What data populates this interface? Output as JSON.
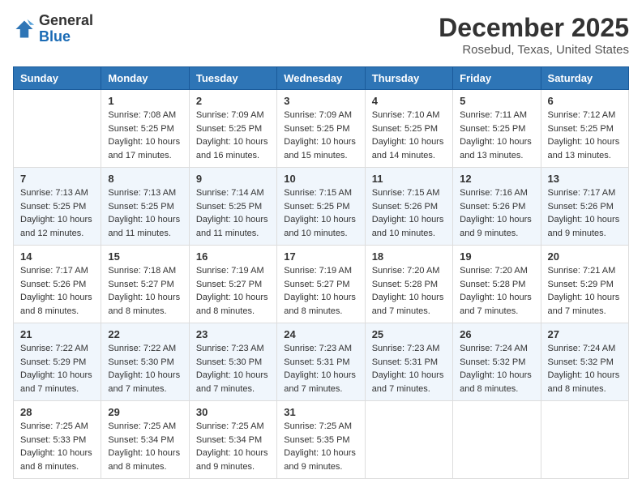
{
  "logo": {
    "general": "General",
    "blue": "Blue"
  },
  "header": {
    "month": "December 2025",
    "location": "Rosebud, Texas, United States"
  },
  "days_of_week": [
    "Sunday",
    "Monday",
    "Tuesday",
    "Wednesday",
    "Thursday",
    "Friday",
    "Saturday"
  ],
  "weeks": [
    [
      {
        "day": "",
        "info": ""
      },
      {
        "day": "1",
        "info": "Sunrise: 7:08 AM\nSunset: 5:25 PM\nDaylight: 10 hours\nand 17 minutes."
      },
      {
        "day": "2",
        "info": "Sunrise: 7:09 AM\nSunset: 5:25 PM\nDaylight: 10 hours\nand 16 minutes."
      },
      {
        "day": "3",
        "info": "Sunrise: 7:09 AM\nSunset: 5:25 PM\nDaylight: 10 hours\nand 15 minutes."
      },
      {
        "day": "4",
        "info": "Sunrise: 7:10 AM\nSunset: 5:25 PM\nDaylight: 10 hours\nand 14 minutes."
      },
      {
        "day": "5",
        "info": "Sunrise: 7:11 AM\nSunset: 5:25 PM\nDaylight: 10 hours\nand 13 minutes."
      },
      {
        "day": "6",
        "info": "Sunrise: 7:12 AM\nSunset: 5:25 PM\nDaylight: 10 hours\nand 13 minutes."
      }
    ],
    [
      {
        "day": "7",
        "info": "Sunrise: 7:13 AM\nSunset: 5:25 PM\nDaylight: 10 hours\nand 12 minutes."
      },
      {
        "day": "8",
        "info": "Sunrise: 7:13 AM\nSunset: 5:25 PM\nDaylight: 10 hours\nand 11 minutes."
      },
      {
        "day": "9",
        "info": "Sunrise: 7:14 AM\nSunset: 5:25 PM\nDaylight: 10 hours\nand 11 minutes."
      },
      {
        "day": "10",
        "info": "Sunrise: 7:15 AM\nSunset: 5:25 PM\nDaylight: 10 hours\nand 10 minutes."
      },
      {
        "day": "11",
        "info": "Sunrise: 7:15 AM\nSunset: 5:26 PM\nDaylight: 10 hours\nand 10 minutes."
      },
      {
        "day": "12",
        "info": "Sunrise: 7:16 AM\nSunset: 5:26 PM\nDaylight: 10 hours\nand 9 minutes."
      },
      {
        "day": "13",
        "info": "Sunrise: 7:17 AM\nSunset: 5:26 PM\nDaylight: 10 hours\nand 9 minutes."
      }
    ],
    [
      {
        "day": "14",
        "info": "Sunrise: 7:17 AM\nSunset: 5:26 PM\nDaylight: 10 hours\nand 8 minutes."
      },
      {
        "day": "15",
        "info": "Sunrise: 7:18 AM\nSunset: 5:27 PM\nDaylight: 10 hours\nand 8 minutes."
      },
      {
        "day": "16",
        "info": "Sunrise: 7:19 AM\nSunset: 5:27 PM\nDaylight: 10 hours\nand 8 minutes."
      },
      {
        "day": "17",
        "info": "Sunrise: 7:19 AM\nSunset: 5:27 PM\nDaylight: 10 hours\nand 8 minutes."
      },
      {
        "day": "18",
        "info": "Sunrise: 7:20 AM\nSunset: 5:28 PM\nDaylight: 10 hours\nand 7 minutes."
      },
      {
        "day": "19",
        "info": "Sunrise: 7:20 AM\nSunset: 5:28 PM\nDaylight: 10 hours\nand 7 minutes."
      },
      {
        "day": "20",
        "info": "Sunrise: 7:21 AM\nSunset: 5:29 PM\nDaylight: 10 hours\nand 7 minutes."
      }
    ],
    [
      {
        "day": "21",
        "info": "Sunrise: 7:22 AM\nSunset: 5:29 PM\nDaylight: 10 hours\nand 7 minutes."
      },
      {
        "day": "22",
        "info": "Sunrise: 7:22 AM\nSunset: 5:30 PM\nDaylight: 10 hours\nand 7 minutes."
      },
      {
        "day": "23",
        "info": "Sunrise: 7:23 AM\nSunset: 5:30 PM\nDaylight: 10 hours\nand 7 minutes."
      },
      {
        "day": "24",
        "info": "Sunrise: 7:23 AM\nSunset: 5:31 PM\nDaylight: 10 hours\nand 7 minutes."
      },
      {
        "day": "25",
        "info": "Sunrise: 7:23 AM\nSunset: 5:31 PM\nDaylight: 10 hours\nand 7 minutes."
      },
      {
        "day": "26",
        "info": "Sunrise: 7:24 AM\nSunset: 5:32 PM\nDaylight: 10 hours\nand 8 minutes."
      },
      {
        "day": "27",
        "info": "Sunrise: 7:24 AM\nSunset: 5:32 PM\nDaylight: 10 hours\nand 8 minutes."
      }
    ],
    [
      {
        "day": "28",
        "info": "Sunrise: 7:25 AM\nSunset: 5:33 PM\nDaylight: 10 hours\nand 8 minutes."
      },
      {
        "day": "29",
        "info": "Sunrise: 7:25 AM\nSunset: 5:34 PM\nDaylight: 10 hours\nand 8 minutes."
      },
      {
        "day": "30",
        "info": "Sunrise: 7:25 AM\nSunset: 5:34 PM\nDaylight: 10 hours\nand 9 minutes."
      },
      {
        "day": "31",
        "info": "Sunrise: 7:25 AM\nSunset: 5:35 PM\nDaylight: 10 hours\nand 9 minutes."
      },
      {
        "day": "",
        "info": ""
      },
      {
        "day": "",
        "info": ""
      },
      {
        "day": "",
        "info": ""
      }
    ]
  ]
}
